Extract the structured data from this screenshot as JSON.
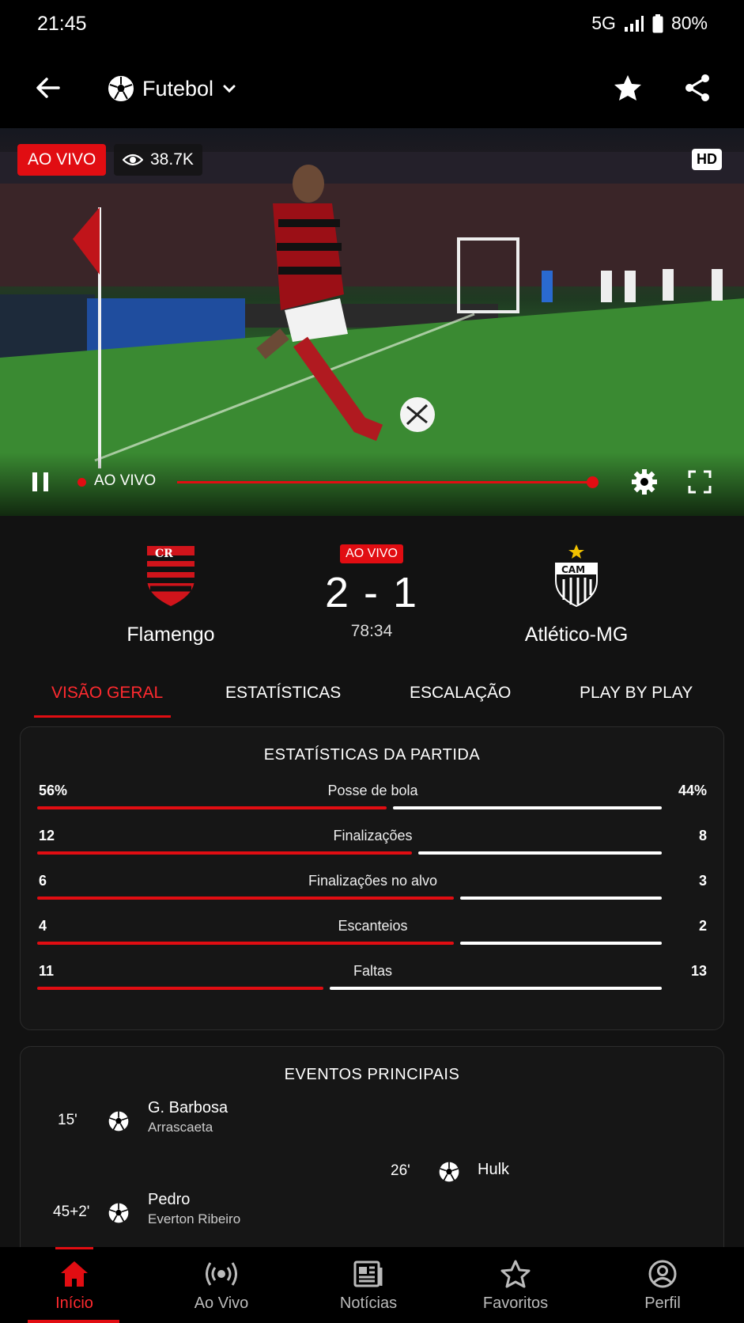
{
  "status_bar": {
    "time": "21:45",
    "network": "5G",
    "battery": "80%"
  },
  "header": {
    "sport": "Futebol",
    "icons": [
      "back-arrow-icon",
      "soccer-ball-icon",
      "chevron-down-icon",
      "star-icon",
      "share-icon"
    ]
  },
  "player": {
    "live_badge": "AO VIVO",
    "viewers": "38.7K",
    "quality": "HD",
    "live_label": "AO VIVO",
    "progress": 1.0,
    "accent": "#e10d12"
  },
  "match": {
    "status": "AO VIVO",
    "home": {
      "name": "Flamengo"
    },
    "away": {
      "name": "Atlético-MG"
    },
    "score": "2 - 1",
    "clock": "78:34"
  },
  "tabs": [
    {
      "label": "VISÃO GERAL",
      "active": true
    },
    {
      "label": "ESTATÍSTICAS",
      "active": false
    },
    {
      "label": "ESCALAÇÃO",
      "active": false
    },
    {
      "label": "PLAY BY PLAY",
      "active": false
    }
  ],
  "stats": {
    "title": "ESTATÍSTICAS DA PARTIDA",
    "rows": [
      {
        "label": "Posse de bola",
        "home": "56%",
        "away": "44%",
        "home_share": 0.56
      },
      {
        "label": "Finalizações",
        "home": "12",
        "away": "8",
        "home_share": 0.6
      },
      {
        "label": "Finalizações no alvo",
        "home": "6",
        "away": "3",
        "home_share": 0.667
      },
      {
        "label": "Escanteios",
        "home": "4",
        "away": "2",
        "home_share": 0.667
      },
      {
        "label": "Faltas",
        "home": "11",
        "away": "13",
        "home_share": 0.458
      }
    ]
  },
  "events": {
    "title": "EVENTOS PRINCIPAIS",
    "items": [
      {
        "minute": "15'",
        "side": "home",
        "player": "G. Barbosa",
        "assist": "Arrascaeta"
      },
      {
        "minute": "26'",
        "side": "away",
        "player": "Hulk",
        "assist": ""
      },
      {
        "minute": "45+2'",
        "side": "home",
        "player": "Pedro",
        "assist": "Everton Ribeiro"
      }
    ]
  },
  "nav": [
    {
      "label": "Início",
      "icon": "home-icon",
      "active": true
    },
    {
      "label": "Ao Vivo",
      "icon": "broadcast-icon",
      "active": false
    },
    {
      "label": "Notícias",
      "icon": "news-icon",
      "active": false
    },
    {
      "label": "Favoritos",
      "icon": "star-outline-icon",
      "active": false
    },
    {
      "label": "Perfil",
      "icon": "profile-icon",
      "active": false
    }
  ]
}
